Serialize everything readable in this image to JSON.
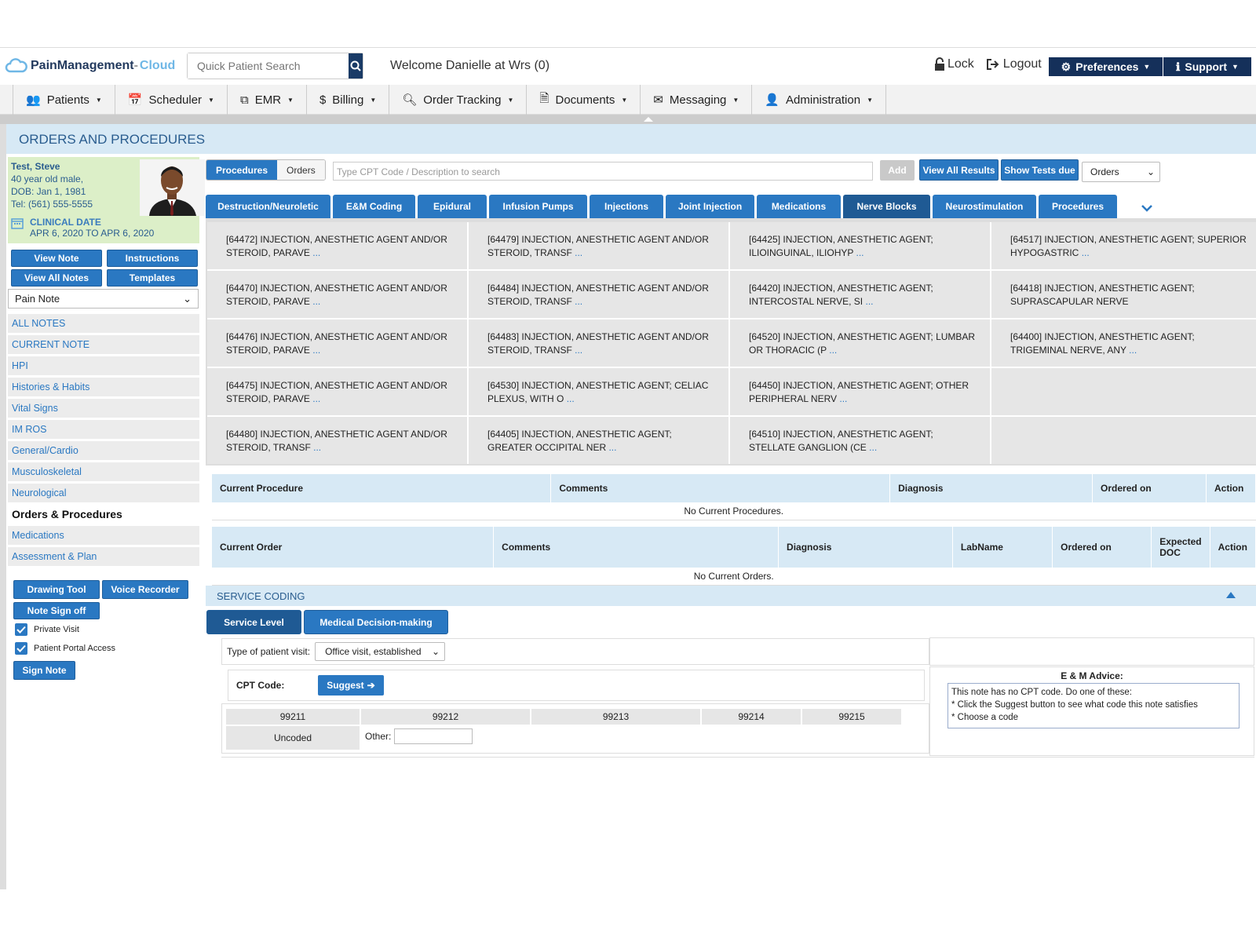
{
  "app": {
    "logo_main": "PainManagement",
    "logo_accent": "Cloud"
  },
  "header": {
    "search_placeholder": "Quick Patient Search",
    "welcome": "Welcome Danielle at Wrs (0)",
    "lock": "Lock",
    "logout": "Logout",
    "preferences": "Preferences",
    "support": "Support"
  },
  "nav": [
    {
      "label": "Patients",
      "icon": "users-icon"
    },
    {
      "label": "Scheduler",
      "icon": "calendar-icon"
    },
    {
      "label": "EMR",
      "icon": "copy-icon"
    },
    {
      "label": "Billing",
      "icon": "dollar-icon"
    },
    {
      "label": "Order Tracking",
      "icon": "search-icon"
    },
    {
      "label": "Documents",
      "icon": "file-icon"
    },
    {
      "label": "Messaging",
      "icon": "envelope-icon"
    },
    {
      "label": "Administration",
      "icon": "user-icon"
    }
  ],
  "page_title": "ORDERS AND PROCEDURES",
  "patient": {
    "name": "Test, Steve",
    "desc": "40 year old male,",
    "dob": "DOB: Jan 1, 1981",
    "tel": "Tel: (561) 555-5555",
    "clinical_label": "CLINICAL DATE",
    "clinical_date": "APR 6, 2020 TO APR 6, 2020"
  },
  "left_buttons": {
    "view_note": "View Note",
    "instructions": "Instructions",
    "view_all_notes": "View All Notes",
    "templates": "Templates"
  },
  "note_select": "Pain Note",
  "sidenav": [
    "ALL NOTES",
    "CURRENT NOTE",
    "HPI",
    "Histories & Habits",
    "Vital Signs",
    "IM ROS",
    "General/Cardio",
    "Musculoskeletal",
    "Neurological",
    "Orders & Procedures",
    "Medications",
    "Assessment & Plan"
  ],
  "tools": {
    "drawing": "Drawing Tool",
    "voice": "Voice Recorder",
    "signoff": "Note Sign off",
    "private": "Private Visit",
    "portal": "Patient Portal Access",
    "sign": "Sign Note"
  },
  "toolbar": {
    "procedures": "Procedures",
    "orders": "Orders",
    "cpt_placeholder": "Type CPT Code / Description to search",
    "add": "Add",
    "view_all_results": "View All Results",
    "show_tests_due": "Show Tests due",
    "orders_select": "Orders"
  },
  "tabs": [
    "Destruction/Neuroletic",
    "E&M Coding",
    "Epidural",
    "Infusion Pumps",
    "Injections",
    "Joint Injection",
    "Medications",
    "Nerve Blocks",
    "Neurostimulation",
    "Procedures"
  ],
  "procedures": [
    [
      "[64472] INJECTION, ANESTHETIC AGENT AND/OR STEROID, PARAVE",
      "[64479] INJECTION, ANESTHETIC AGENT AND/OR STEROID, TRANSF",
      "[64425] INJECTION, ANESTHETIC AGENT; ILIOINGUINAL, ILIOHYP",
      "[64517] INJECTION, ANESTHETIC AGENT; SUPERIOR HYPOGASTRIC"
    ],
    [
      "[64470] INJECTION, ANESTHETIC AGENT AND/OR STEROID, PARAVE",
      "[64484] INJECTION, ANESTHETIC AGENT AND/OR STEROID, TRANSF",
      "[64420] INJECTION, ANESTHETIC AGENT; INTERCOSTAL NERVE, SI",
      "[64418] INJECTION, ANESTHETIC AGENT; SUPRASCAPULAR NERVE"
    ],
    [
      "[64476] INJECTION, ANESTHETIC AGENT AND/OR STEROID, PARAVE",
      "[64483] INJECTION, ANESTHETIC AGENT AND/OR STEROID, TRANSF",
      "[64520] INJECTION, ANESTHETIC AGENT; LUMBAR OR THORACIC (P",
      "[64400] INJECTION, ANESTHETIC AGENT; TRIGEMINAL NERVE, ANY"
    ],
    [
      "[64475] INJECTION, ANESTHETIC AGENT AND/OR STEROID, PARAVE",
      "[64530] INJECTION, ANESTHETIC AGENT; CELIAC PLEXUS, WITH O",
      "[64450] INJECTION, ANESTHETIC AGENT; OTHER PERIPHERAL NERV",
      ""
    ],
    [
      "[64480] INJECTION, ANESTHETIC AGENT AND/OR STEROID, TRANSF",
      "[64405] INJECTION, ANESTHETIC AGENT; GREATER OCCIPITAL NER",
      "[64510] INJECTION, ANESTHETIC AGENT; STELLATE GANGLION (CE",
      ""
    ]
  ],
  "proc_more": [
    [
      true,
      true,
      true,
      true
    ],
    [
      true,
      true,
      true,
      false
    ],
    [
      true,
      true,
      true,
      true
    ],
    [
      true,
      true,
      true,
      false
    ],
    [
      true,
      true,
      true,
      false
    ]
  ],
  "current_procedures": {
    "headers": [
      "Current Procedure",
      "Comments",
      "Diagnosis",
      "Ordered on",
      "Action"
    ],
    "empty": "No Current Procedures."
  },
  "current_orders": {
    "headers": [
      "Current Order",
      "Comments",
      "Diagnosis",
      "LabName",
      "Ordered on",
      "Expected DOC",
      "Action"
    ],
    "empty": "No Current Orders."
  },
  "service_coding": {
    "title": "SERVICE CODING",
    "tab_service": "Service Level",
    "tab_mdm": "Medical Decision-making",
    "visit_label": "Type of patient visit:",
    "visit_value": "Office visit, established",
    "cpt_label": "CPT Code:",
    "suggest": "Suggest",
    "codes": [
      "99211",
      "99212",
      "99213",
      "99214",
      "99215"
    ],
    "uncoded": "Uncoded",
    "other": "Other:",
    "advice_title": "E & M Advice:",
    "advice_lines": [
      "This note has no CPT code. Do one of these:",
      "* Click the Suggest button to see what code this note satisfies",
      "* Choose a code"
    ]
  },
  "colors": {
    "primary": "#2a78c2",
    "dark": "#15305a",
    "header_bg": "#d7e9f5",
    "patient_bg": "#dcefc8"
  }
}
